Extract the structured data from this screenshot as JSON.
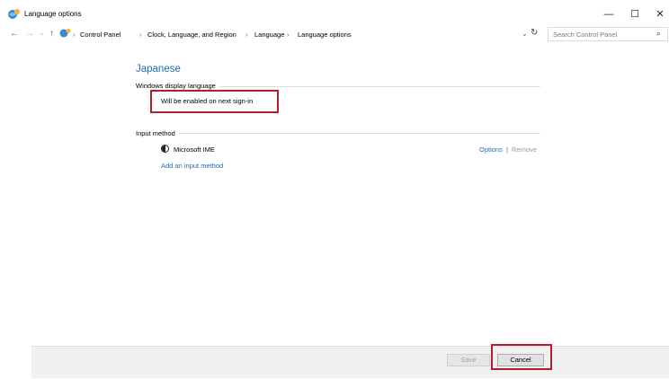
{
  "window": {
    "title": "Language options",
    "controls": {
      "minimize": "—",
      "maximize": "☐",
      "close": "✕"
    }
  },
  "address_bar": {
    "nav": {
      "back": "←",
      "forward": "→",
      "recent": "⌄",
      "up": "↑"
    },
    "breadcrumbs": [
      "Control Panel",
      "Clock, Language, and Region",
      "Language",
      "Language options"
    ],
    "separator": "›",
    "refresh": "↻",
    "search_placeholder": "Search Control Panel",
    "search_icon": "⌕"
  },
  "main": {
    "language_name": "Japanese",
    "display_language": {
      "heading": "Windows display language",
      "status": "Will be enabled on next sign-in"
    },
    "input_method": {
      "heading": "Input method",
      "items": [
        {
          "name": "Microsoft IME",
          "options_label": "Options",
          "separator": "|",
          "remove_label": "Remove"
        }
      ],
      "add_label": "Add an input method"
    }
  },
  "footer": {
    "save_label": "Save",
    "cancel_label": "Cancel"
  },
  "colors": {
    "link": "#1e6bb8",
    "highlight": "#b0202a"
  }
}
